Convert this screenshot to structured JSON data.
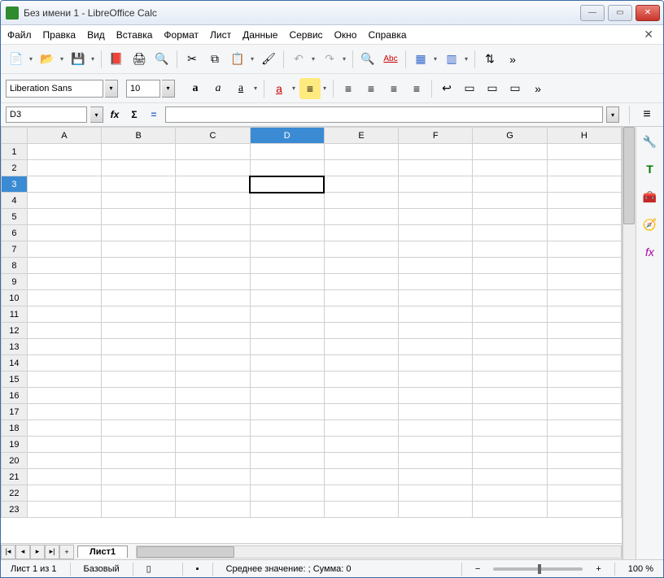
{
  "window": {
    "title": "Без имени 1 - LibreOffice Calc"
  },
  "menu": {
    "file": "Файл",
    "edit": "Правка",
    "view": "Вид",
    "insert": "Вставка",
    "format": "Формат",
    "sheet": "Лист",
    "data": "Данные",
    "service": "Сервис",
    "window": "Окно",
    "help": "Справка"
  },
  "font": {
    "name": "Liberation Sans",
    "size": "10"
  },
  "formats": {
    "bold": "a",
    "italic": "a",
    "underline": "a"
  },
  "namebox": {
    "ref": "D3"
  },
  "columns": [
    "A",
    "B",
    "C",
    "D",
    "E",
    "F",
    "G",
    "H"
  ],
  "active_col": "D",
  "active_row": 3,
  "rows": 23,
  "tabs": {
    "sheet1": "Лист1",
    "add": "+"
  },
  "nav": {
    "first": "|◂",
    "prev": "◂",
    "next": "▸",
    "last": "▸|"
  },
  "status": {
    "sheet_count": "Лист 1 из 1",
    "style": "Базовый",
    "summary": "Среднее значение: ; Сумма: 0",
    "zoom": "100 %",
    "minus": "−",
    "plus": "+"
  },
  "icons": {
    "spellcheck": "Abc",
    "sigma": "Σ",
    "eq": "=",
    "fx": "fх"
  }
}
